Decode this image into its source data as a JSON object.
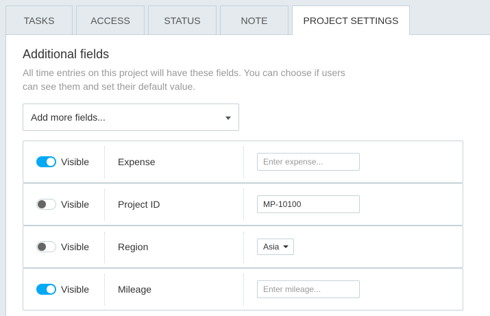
{
  "tabs": [
    {
      "label": "TASKS"
    },
    {
      "label": "ACCESS"
    },
    {
      "label": "STATUS"
    },
    {
      "label": "NOTE"
    },
    {
      "label": "PROJECT SETTINGS",
      "active": true
    }
  ],
  "section": {
    "title": "Additional fields",
    "description": "All time entries on this project will have these fields. You can choose if users can see them and set their default value.",
    "add_fields_label": "Add more fields..."
  },
  "fields": [
    {
      "visible_label": "Visible",
      "visible": true,
      "name": "Expense",
      "input_type": "text",
      "value": "",
      "placeholder": "Enter expense..."
    },
    {
      "visible_label": "Visible",
      "visible": false,
      "name": "Project ID",
      "input_type": "text",
      "value": "MP-10100",
      "placeholder": ""
    },
    {
      "visible_label": "Visible",
      "visible": false,
      "name": "Region",
      "input_type": "select",
      "value": "Asia"
    },
    {
      "visible_label": "Visible",
      "visible": true,
      "name": "Mileage",
      "input_type": "text",
      "value": "",
      "placeholder": "Enter mileage..."
    }
  ],
  "colors": {
    "accent": "#03a9f4",
    "background": "#e4eaee",
    "border": "#c6d2d9"
  }
}
